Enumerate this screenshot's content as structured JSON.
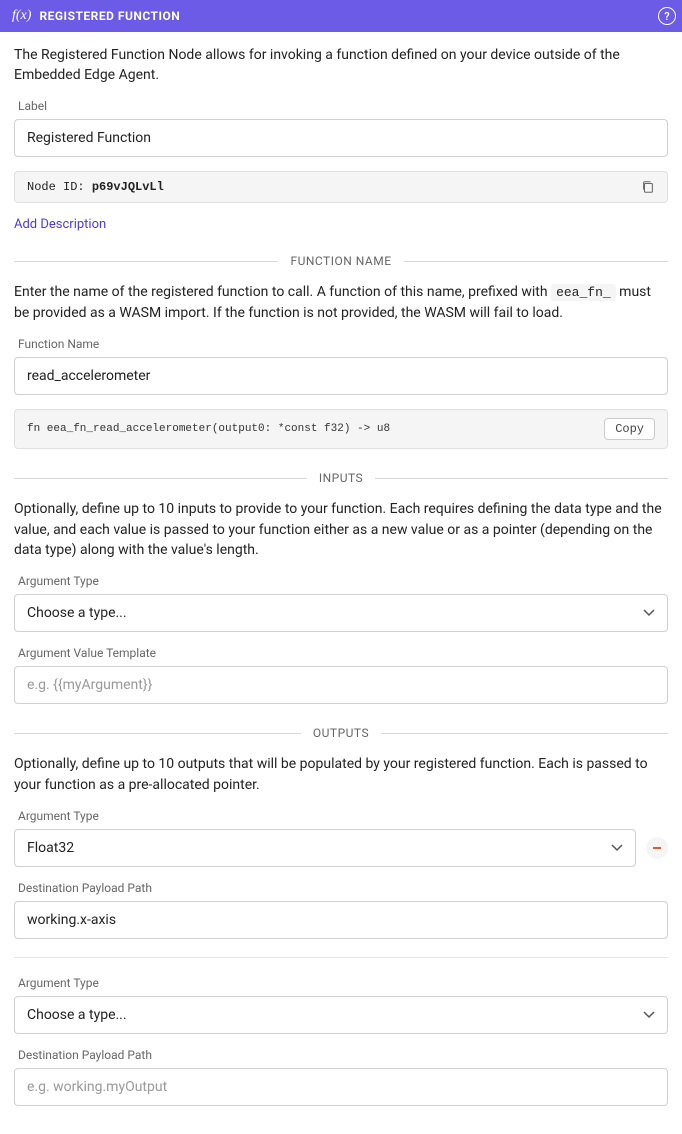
{
  "header": {
    "title": "REGISTERED FUNCTION",
    "icon_glyph": "f(x)",
    "help_glyph": "?"
  },
  "intro": "The Registered Function Node allows for invoking a function defined on your device outside of the Embedded Edge Agent.",
  "labelField": {
    "label": "Label",
    "value": "Registered Function"
  },
  "nodeId": {
    "label": "Node ID:",
    "value": "p69vJQLvLl"
  },
  "addDescription": "Add Description",
  "functionNameSection": {
    "title": "FUNCTION NAME",
    "helper_pre": "Enter the name of the registered function to call. A function of this name, prefixed with ",
    "helper_code": "eea_fn_",
    "helper_post": " must be provided as a WASM import. If the function is not provided, the WASM will fail to load.",
    "fieldLabel": "Function Name",
    "value": "read_accelerometer",
    "signature": "fn eea_fn_read_accelerometer(output0: *const f32) -> u8",
    "copyLabel": "Copy"
  },
  "inputsSection": {
    "title": "INPUTS",
    "helper": "Optionally, define up to 10 inputs to provide to your function. Each requires defining the data type and the value, and each value is passed to your function either as a new value or as a pointer (depending on the data type) along with the value's length.",
    "argTypeLabel": "Argument Type",
    "argTypePlaceholder": "Choose a type...",
    "argValueLabel": "Argument Value Template",
    "argValuePlaceholder": "e.g. {{myArgument}}"
  },
  "outputsSection": {
    "title": "OUTPUTS",
    "helper": "Optionally, define up to 10 outputs that will be populated by your registered function. Each is passed to your function as a pre-allocated pointer.",
    "rows": [
      {
        "argTypeLabel": "Argument Type",
        "argTypeValue": "Float32",
        "destLabel": "Destination Payload Path",
        "destValue": "working.x-axis"
      },
      {
        "argTypeLabel": "Argument Type",
        "argTypeValue": "Choose a type...",
        "destLabel": "Destination Payload Path",
        "destPlaceholder": "e.g. working.myOutput"
      }
    ]
  }
}
